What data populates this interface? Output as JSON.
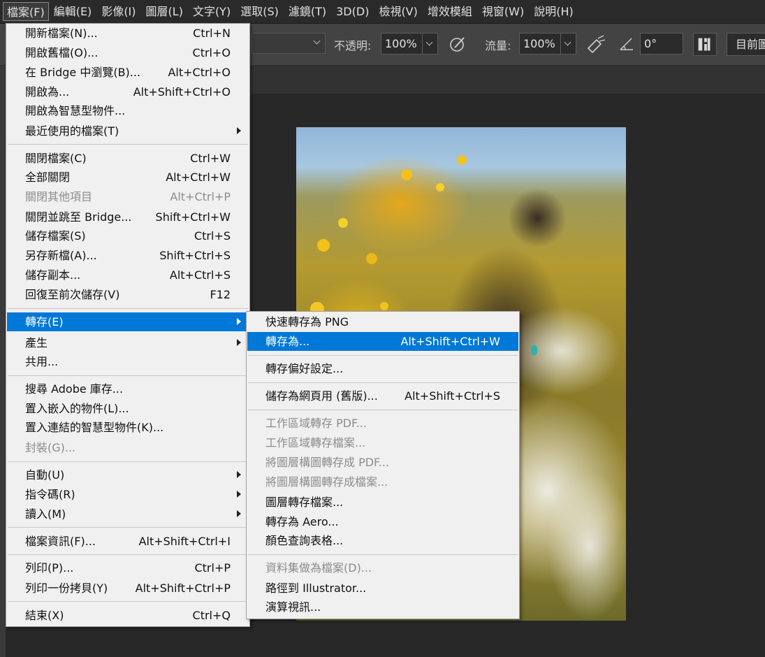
{
  "menubar": {
    "items": [
      "檔案(F)",
      "編輯(E)",
      "影像(I)",
      "圖層(L)",
      "文字(Y)",
      "選取(S)",
      "濾鏡(T)",
      "3D(D)",
      "檢視(V)",
      "增效模組",
      "視窗(W)",
      "說明(H)"
    ]
  },
  "options": {
    "opacity_label": "不透明:",
    "opacity_value": "100%",
    "flow_label": "流量:",
    "flow_value": "100%",
    "angle_value": "0°",
    "sample_label": "目前圖"
  },
  "file_menu": {
    "items": [
      {
        "label": "開新檔案(N)...",
        "shortcut": "Ctrl+N"
      },
      {
        "label": "開啟舊檔(O)...",
        "shortcut": "Ctrl+O"
      },
      {
        "label": "在 Bridge 中瀏覽(B)...",
        "shortcut": "Alt+Ctrl+O"
      },
      {
        "label": "開啟為...",
        "shortcut": "Alt+Shift+Ctrl+O"
      },
      {
        "label": "開啟為智慧型物件...",
        "shortcut": ""
      },
      {
        "label": "最近使用的檔案(T)",
        "shortcut": "",
        "submenu": true
      },
      {
        "label": "關閉檔案(C)",
        "shortcut": "Ctrl+W"
      },
      {
        "label": "全部關閉",
        "shortcut": "Alt+Ctrl+W"
      },
      {
        "label": "關閉其他項目",
        "shortcut": "Alt+Ctrl+P",
        "disabled": true
      },
      {
        "label": "關閉並跳至 Bridge...",
        "shortcut": "Shift+Ctrl+W"
      },
      {
        "label": "儲存檔案(S)",
        "shortcut": "Ctrl+S"
      },
      {
        "label": "另存新檔(A)...",
        "shortcut": "Shift+Ctrl+S"
      },
      {
        "label": "儲存副本...",
        "shortcut": "Alt+Ctrl+S"
      },
      {
        "label": "回復至前次儲存(V)",
        "shortcut": "F12"
      },
      {
        "label": "轉存(E)",
        "shortcut": "",
        "submenu": true,
        "highlighted": true
      },
      {
        "label": "產生",
        "shortcut": "",
        "submenu": true
      },
      {
        "label": "共用...",
        "shortcut": ""
      },
      {
        "label": "搜尋 Adobe 庫存...",
        "shortcut": ""
      },
      {
        "label": "置入嵌入的物件(L)...",
        "shortcut": ""
      },
      {
        "label": "置入連結的智慧型物件(K)...",
        "shortcut": ""
      },
      {
        "label": "封裝(G)...",
        "shortcut": "",
        "disabled": true
      },
      {
        "label": "自動(U)",
        "shortcut": "",
        "submenu": true
      },
      {
        "label": "指令碼(R)",
        "shortcut": "",
        "submenu": true
      },
      {
        "label": "讀入(M)",
        "shortcut": "",
        "submenu": true
      },
      {
        "label": "檔案資訊(F)...",
        "shortcut": "Alt+Shift+Ctrl+I"
      },
      {
        "label": "列印(P)...",
        "shortcut": "Ctrl+P"
      },
      {
        "label": "列印一份拷貝(Y)",
        "shortcut": "Alt+Shift+Ctrl+P"
      },
      {
        "label": "結束(X)",
        "shortcut": "Ctrl+Q"
      }
    ]
  },
  "export_menu": {
    "items": [
      {
        "label": "快速轉存為 PNG",
        "shortcut": ""
      },
      {
        "label": "轉存為...",
        "shortcut": "Alt+Shift+Ctrl+W",
        "highlighted": true
      },
      {
        "label": "轉存偏好設定...",
        "shortcut": ""
      },
      {
        "label": "儲存為網頁用 (舊版)...",
        "shortcut": "Alt+Shift+Ctrl+S"
      },
      {
        "label": "工作區域轉存 PDF...",
        "shortcut": "",
        "disabled": true
      },
      {
        "label": "工作區域轉存檔案...",
        "shortcut": "",
        "disabled": true
      },
      {
        "label": "將圖層構圖轉存成 PDF...",
        "shortcut": "",
        "disabled": true
      },
      {
        "label": "將圖層構圖轉存成檔案...",
        "shortcut": "",
        "disabled": true
      },
      {
        "label": "圖層轉存檔案...",
        "shortcut": ""
      },
      {
        "label": "轉存為 Aero...",
        "shortcut": ""
      },
      {
        "label": "顏色查詢表格...",
        "shortcut": ""
      },
      {
        "label": "資料集做為檔案(D)...",
        "shortcut": "",
        "disabled": true
      },
      {
        "label": "路徑到 Illustrator...",
        "shortcut": ""
      },
      {
        "label": "演算視訊...",
        "shortcut": ""
      }
    ]
  },
  "colors": {
    "highlight": "#0078d7",
    "menu_bg": "#f0f0f0",
    "app_bg": "#282828"
  }
}
